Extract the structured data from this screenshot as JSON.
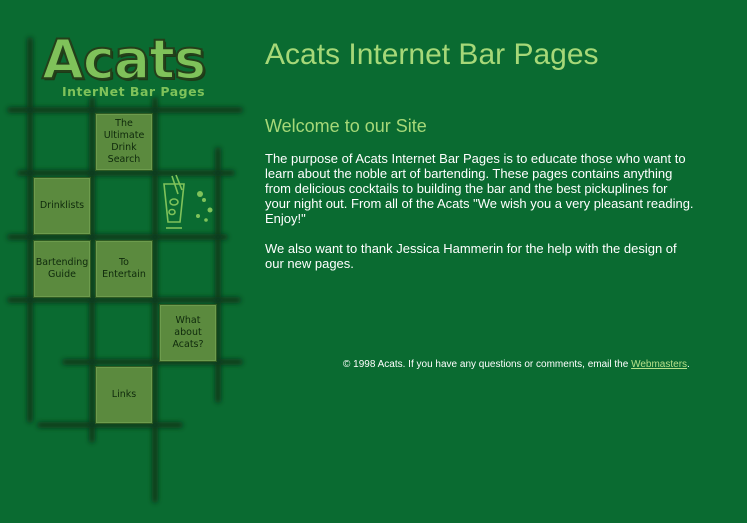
{
  "logo": {
    "main": "Acats",
    "sub": "InterNet  Bar Pages"
  },
  "nav": {
    "ultimate": "The\nUltimate\nDrink\nSearch",
    "drinklists": "Drinklists",
    "bartending": "Bartending\nGuide",
    "entertain": "To\nEntertain",
    "acats": "What\nabout\nAcats?",
    "links": "Links"
  },
  "main": {
    "title": "Acats Internet Bar Pages",
    "welcome": "Welcome to our Site",
    "intro": "The purpose of Acats Internet Bar Pages is to educate those who want to learn about the noble art of bartending. These pages contains anything from delicious cocktails to building the bar and the best pickuplines for your night out. From all of the Acats \"We wish you a very pleasant reading. Enjoy!\"",
    "thanks": "We also want to thank Jessica Hammerin for the help with the design of our new pages."
  },
  "footer": {
    "text": "© 1998 Acats. If you have any questions or comments, email the ",
    "link": "Webmasters",
    "end": "."
  },
  "colors": {
    "background": "#0a6b31",
    "heading": "#a6d878",
    "tile": "#5b8a3e",
    "grid_lines": "#0f3a1c"
  },
  "icons": {
    "glass": "cocktail-glass-icon"
  }
}
